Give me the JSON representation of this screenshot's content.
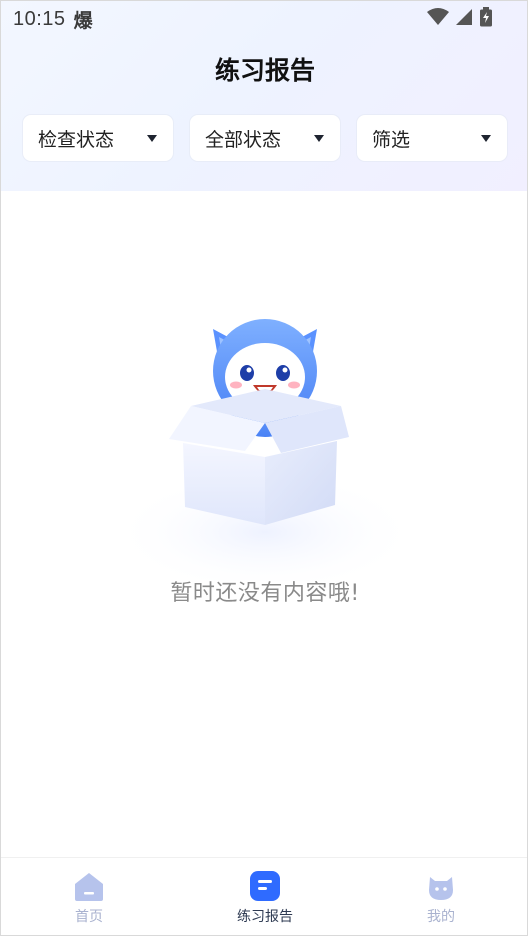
{
  "status_bar": {
    "time": "10:15",
    "carrier_glyph": "爆",
    "icons": [
      "wifi-icon",
      "signal-icon",
      "battery-icon"
    ]
  },
  "page": {
    "title": "练习报告"
  },
  "filters": [
    {
      "label": "检查状态"
    },
    {
      "label": "全部状态"
    },
    {
      "label": "筛选"
    }
  ],
  "empty_state": {
    "message": "暂时还没有内容哦!",
    "illustration": "cat-mascot-in-box"
  },
  "bottom_nav": {
    "items": [
      {
        "label": "首页",
        "icon": "home-icon",
        "active": false
      },
      {
        "label": "练习报告",
        "icon": "report-icon",
        "active": true
      },
      {
        "label": "我的",
        "icon": "profile-cat-icon",
        "active": false
      }
    ]
  },
  "colors": {
    "accent": "#2f6bff",
    "nav_inactive": "#a9b2cf",
    "header_bg": "#eef3ff"
  }
}
